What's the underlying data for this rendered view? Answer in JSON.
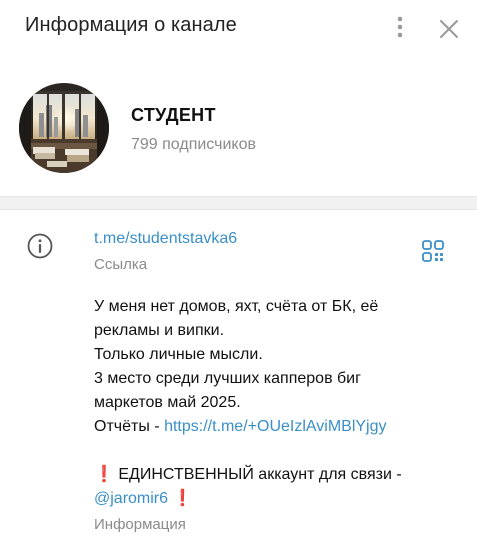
{
  "header": {
    "title": "Информация о канале"
  },
  "channel": {
    "name": "СТУДЕНТ",
    "subscribers": "799 подписчиков"
  },
  "link": {
    "url": "t.me/studentstavka6",
    "caption": "Ссылка"
  },
  "description": {
    "line1": "У меня нет домов, яхт, счёта от БК, её",
    "line2": "рекламы и випки.",
    "line3": "Только личные мысли.",
    "line4": "3 место среди лучших капперов биг",
    "line5": "маркетов май 2025.",
    "reports_prefix": "Отчёты - ",
    "reports_link": "https://t.me/+OUeIzlAviMBlYjgy",
    "exclamation": "❗",
    "contact_text": " ЕДИНСТВЕННЫЙ аккаунт для связи -",
    "contact_username": "@jaromir6",
    "caption": "Информация"
  },
  "colors": {
    "link": "#3a8fc7",
    "muted": "#8a8a8a",
    "accent_red": "#e0202a"
  },
  "icons": {
    "menu": "vertical-dots-icon",
    "close": "close-icon",
    "info": "info-circle-icon",
    "qr": "qr-code-icon"
  }
}
